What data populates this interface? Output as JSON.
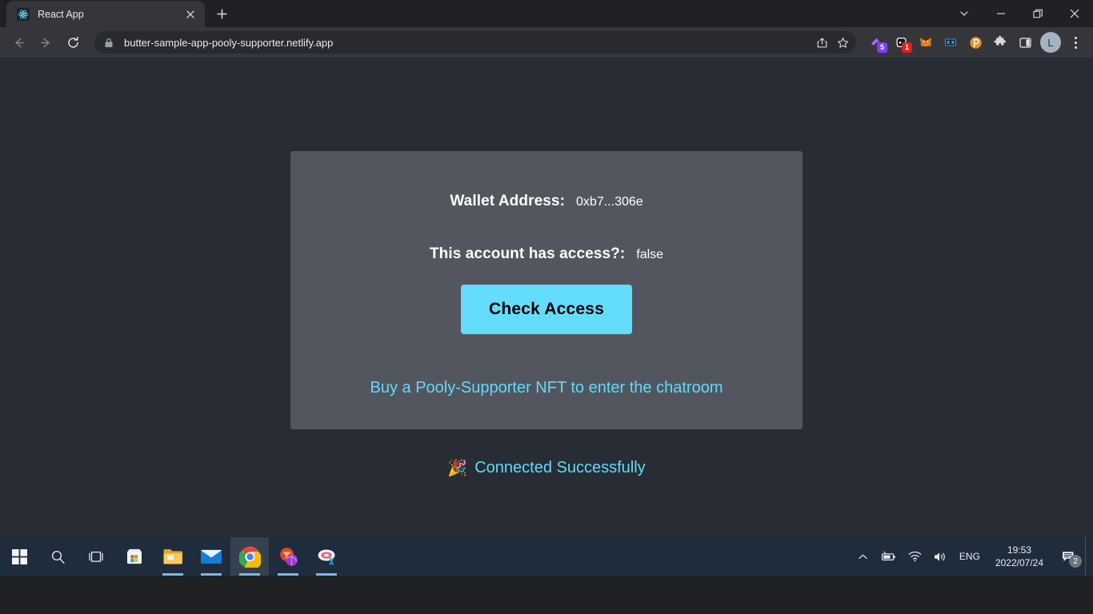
{
  "browser": {
    "tab": {
      "title": "React App",
      "favicon_icon": "react-logo-icon",
      "close_icon": "close-icon"
    },
    "newtab_icon": "plus-icon",
    "window_controls": {
      "tab_search_icon": "chevron-down-icon",
      "minimize_icon": "minimize-icon",
      "maximize_icon": "restore-icon",
      "close_icon": "close-icon"
    },
    "nav": {
      "back_icon": "arrow-left-icon",
      "forward_icon": "arrow-right-icon",
      "reload_icon": "reload-icon"
    },
    "omnibox": {
      "url": "butter-sample-app-pooly-supporter.netlify.app",
      "lock_icon": "lock-icon",
      "share_icon": "share-icon",
      "bookmark_icon": "star-icon"
    },
    "extensions": [
      {
        "name": "purple-diamond-extension",
        "icon": "diamond-icon",
        "badge": "5",
        "badge_color": "#7e3ff2",
        "color": "#8e2de2"
      },
      {
        "name": "notes-extension",
        "icon": "note-icon",
        "badge": "1",
        "badge_color": "#e02020",
        "color": "#1d1d1f"
      },
      {
        "name": "metamask-extension",
        "icon": "fox-icon",
        "badge": "",
        "badge_color": "",
        "color": "#e2761b"
      },
      {
        "name": "blue-grid-extension",
        "icon": "grid-icon",
        "badge": "",
        "badge_color": "",
        "color": "#2f9bd8"
      },
      {
        "name": "pocket-extension",
        "icon": "p-circle-icon",
        "badge": "",
        "badge_color": "",
        "color": "#f08a24"
      },
      {
        "name": "extensions-menu",
        "icon": "puzzle-icon",
        "badge": "",
        "badge_color": "",
        "color": "#d8dadd"
      },
      {
        "name": "side-panel",
        "icon": "side-panel-icon",
        "badge": "",
        "badge_color": "",
        "color": "#e3e5e8"
      }
    ],
    "profile": {
      "initial": "L",
      "icon": "avatar-icon"
    },
    "menu_icon": "kebab-menu-icon"
  },
  "page": {
    "wallet": {
      "label": "Wallet Address:",
      "value": "0xb7...306e"
    },
    "access": {
      "label": "This account has access?:",
      "value": "false"
    },
    "check_button": {
      "label": "Check Access",
      "color": "#64dcfb"
    },
    "buy_link": {
      "label": "Buy a Pooly-Supporter NFT to enter the chatroom",
      "color": "#61dafb"
    },
    "status": {
      "emoji": "🎉",
      "label": "Connected Successfully",
      "color": "#61dafb"
    },
    "colors": {
      "background": "#282c34",
      "card": "#53565f"
    }
  },
  "taskbar": {
    "items": [
      {
        "name": "start-button",
        "icon": "windows-logo-icon"
      },
      {
        "name": "search-button",
        "icon": "search-icon"
      },
      {
        "name": "task-view-button",
        "icon": "task-view-icon"
      },
      {
        "name": "microsoft-store",
        "icon": "store-icon"
      },
      {
        "name": "file-explorer",
        "icon": "folder-icon"
      },
      {
        "name": "mail-app",
        "icon": "mail-icon"
      },
      {
        "name": "google-chrome",
        "icon": "chrome-icon"
      },
      {
        "name": "media-app",
        "icon": "media-app-icon"
      },
      {
        "name": "paint-app",
        "icon": "paint-app-icon"
      }
    ],
    "tray": {
      "overflow_icon": "chevron-up-icon",
      "battery_icon": "battery-icon",
      "wifi_icon": "wifi-icon",
      "volume_icon": "volume-icon",
      "language": "ENG",
      "time": "19:53",
      "date": "2022/07/24",
      "notification_icon": "notification-icon",
      "notification_count": "2"
    }
  }
}
